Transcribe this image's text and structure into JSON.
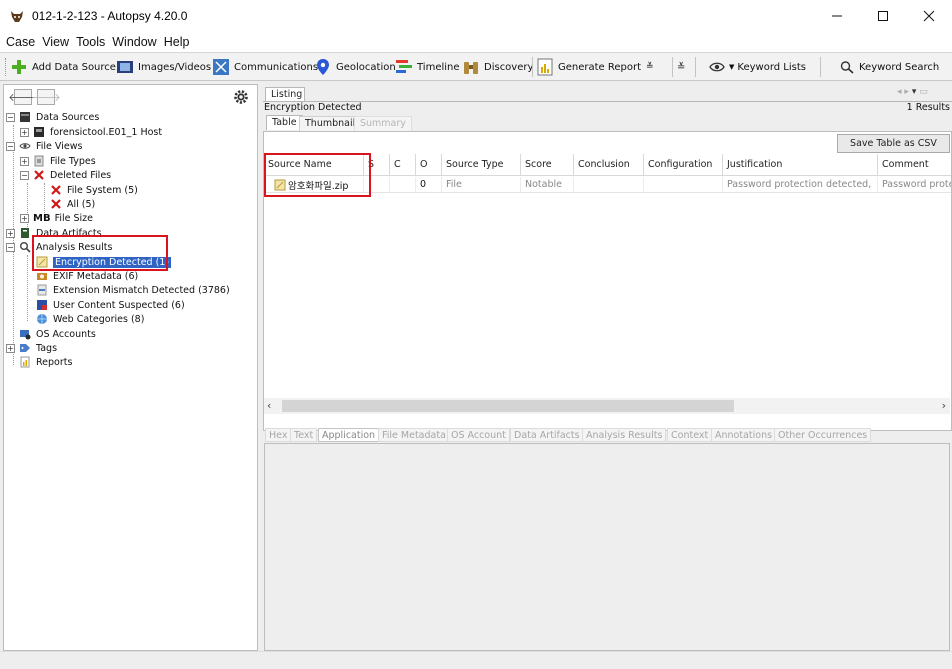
{
  "window": {
    "title": "012-1-2-123 - Autopsy 4.20.0",
    "controls": {
      "minimize": "—",
      "maximize": "☐",
      "close": "✕"
    }
  },
  "menu": [
    "Case",
    "View",
    "Tools",
    "Window",
    "Help"
  ],
  "toolbar": {
    "add_data_source": "Add Data Source",
    "images_videos": "Images/Videos",
    "communications": "Communications",
    "geolocation": "Geolocation",
    "timeline": "Timeline",
    "discovery": "Discovery",
    "generate_report": "Generate Report",
    "keyword_lists": "Keyword Lists",
    "keyword_search": "Keyword Search"
  },
  "tree": {
    "data_sources": "Data Sources",
    "host": "forensictool.E01_1 Host",
    "file_views": "File Views",
    "file_types": "File Types",
    "deleted_files": "Deleted Files",
    "file_system": "File System (5)",
    "all": "All (5)",
    "mb_prefix": "MB",
    "file_size": "File Size",
    "data_artifacts": "Data Artifacts",
    "analysis_results": "Analysis Results",
    "encryption_detected": "Encryption Detected (1)",
    "exif_metadata": "EXIF Metadata (6)",
    "extension_mismatch": "Extension Mismatch Detected (3786)",
    "user_content_suspected": "User Content Suspected (6)",
    "web_categories": "Web Categories (8)",
    "os_accounts": "OS Accounts",
    "tags": "Tags",
    "reports": "Reports"
  },
  "listing": {
    "tab": "Listing",
    "heading": "Encryption Detected",
    "results": "1 Results",
    "subtabs": [
      "Table",
      "Thumbnail",
      "Summary"
    ],
    "save_csv": "Save Table as CSV",
    "columns": [
      "Source Name",
      "S",
      "C",
      "O",
      "Source Type",
      "Score",
      "Conclusion",
      "Configuration",
      "Justification",
      "Comment"
    ],
    "row": {
      "source_name": "암호화파일.zip",
      "s": "",
      "c": "",
      "o": "0",
      "source_type": "File",
      "score": "Notable",
      "conclusion": "",
      "configuration": "",
      "justification": "Password protection detected,",
      "comment": "Password prote"
    }
  },
  "content_tabs": [
    "Hex",
    "Text",
    "Application",
    "File Metadata",
    "OS Account",
    "Data Artifacts",
    "Analysis Results",
    "Context",
    "Annotations",
    "Other Occurrences"
  ],
  "colors": {
    "selection": "#2f64c4",
    "highlight_box": "#d8141e",
    "panel_border": "#bdbdbd"
  }
}
